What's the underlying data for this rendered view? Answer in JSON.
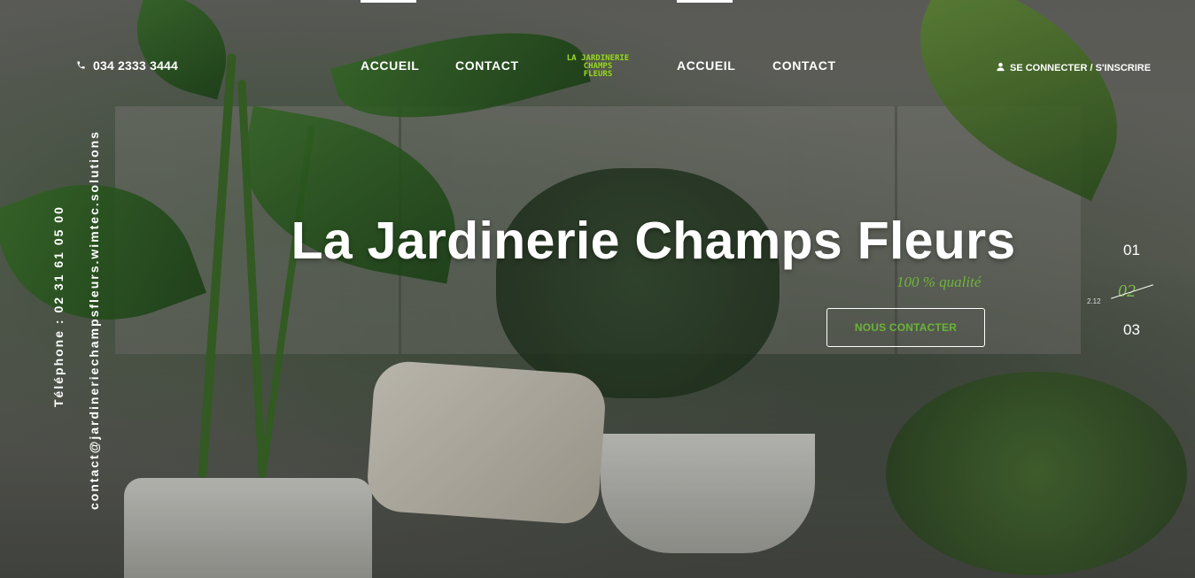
{
  "header": {
    "phone": "034 2333 3444",
    "nav_left": [
      "ACCUEIL",
      "CONTACT"
    ],
    "nav_right": [
      "ACCUEIL",
      "CONTACT"
    ],
    "logo_lines": [
      "LA JARDINERIE",
      "CHAMPS",
      "FLEURS"
    ],
    "login": "SE CONNECTER / S'INSCRIRE"
  },
  "side": {
    "phone": "Téléphone : 02 31 61 05 00",
    "email": "contact@jardineriechampsfleurs.wimtec.solutions"
  },
  "hero": {
    "title": "La Jardinerie Champs Fleurs",
    "subtitle": "100 % qualité",
    "cta": "NOUS CONTACTER"
  },
  "slider": {
    "items": [
      "01",
      "02",
      "03"
    ],
    "active_index": 1,
    "mini_label": "2.12"
  },
  "colors": {
    "accent": "#6cb33a",
    "logo": "#9bd82b",
    "text": "#ffffff"
  },
  "icons": [
    "phone-icon",
    "user-icon"
  ]
}
